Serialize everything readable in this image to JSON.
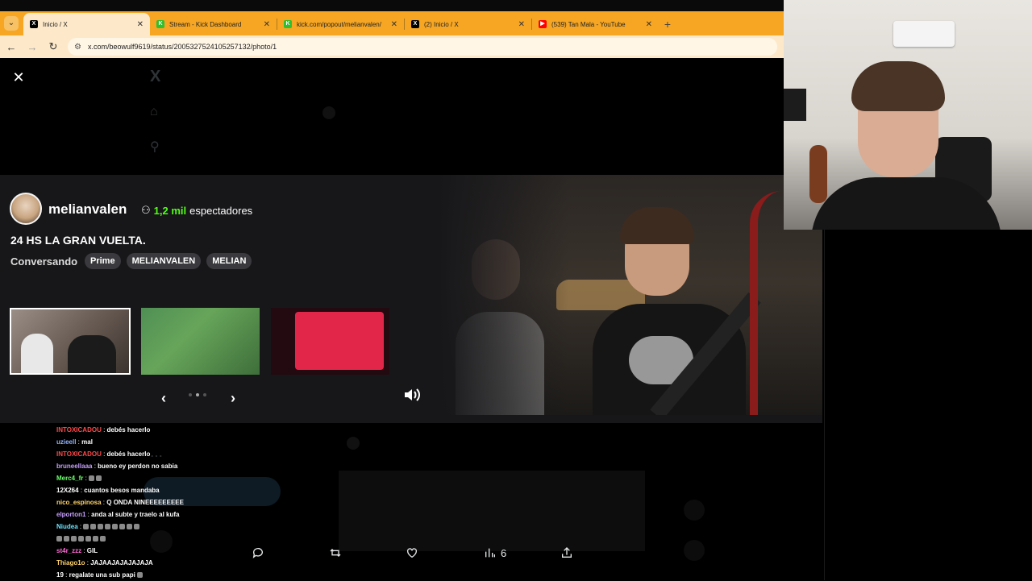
{
  "browser": {
    "tabs": [
      {
        "title": "Inicio / X",
        "favicon": "x-logo-icon",
        "active": true
      },
      {
        "title": "Stream - Kick Dashboard",
        "favicon": "kick-icon",
        "active": false
      },
      {
        "title": "kick.com/popout/melianvalen/",
        "favicon": "kick-icon",
        "active": false
      },
      {
        "title": "(2) Inicio / X",
        "favicon": "x-logo-icon",
        "active": false
      },
      {
        "title": "(539) Tan Mala - YouTube",
        "favicon": "youtube-icon",
        "active": false
      }
    ],
    "url": "x.com/beowulf9619/status/2005327524105257132/photo/1"
  },
  "tweet_actions": {
    "views_count": "6"
  },
  "stream_overlay": {
    "channel_name": "melianvalen",
    "viewer_count": "1,2 mil",
    "viewer_label": "espectadores",
    "title": "24 HS LA GRAN VUELTA.",
    "category": "Conversando",
    "tags": [
      "Prime",
      "MELIANVALEN",
      "MELIAN"
    ],
    "accent_color": "#53fc18"
  },
  "chat": {
    "messages": [
      {
        "user": "INTOXICADOU",
        "color": "#ff4a4a",
        "text": "debés hacerlo"
      },
      {
        "user": "uzieell",
        "color": "#8fb3ff",
        "text": "mal"
      },
      {
        "user": "INTOXICADOU",
        "color": "#ff4a4a",
        "text": "debés hacerlo"
      },
      {
        "user": "bruneellaaa",
        "color": "#c8a0ff",
        "text": "bueno ey perdon no sabia"
      },
      {
        "user": "Merc4_fr",
        "color": "#6cff6c",
        "text": ""
      },
      {
        "user": "12X264",
        "color": "#ffffff",
        "text": "cuantos besos mandaba"
      },
      {
        "user": "nico_espinosa",
        "color": "#ffd36b",
        "text": "Q ONDA NINEEEEEEEEE"
      },
      {
        "user": "elporton1",
        "color": "#c8a0ff",
        "text": "anda al subte y traelo al kufa"
      },
      {
        "user": "Niudea",
        "color": "#6be6ff",
        "text": ""
      },
      {
        "user": "st4r_zzz",
        "color": "#ff6bd6",
        "text": "GIL"
      },
      {
        "user": "Thiago1o",
        "color": "#ffd36b",
        "text": "JAJAAJAJAJAJAJA"
      },
      {
        "user": "19",
        "color": "#ffffff",
        "text": "regalate una sub papi"
      }
    ]
  }
}
